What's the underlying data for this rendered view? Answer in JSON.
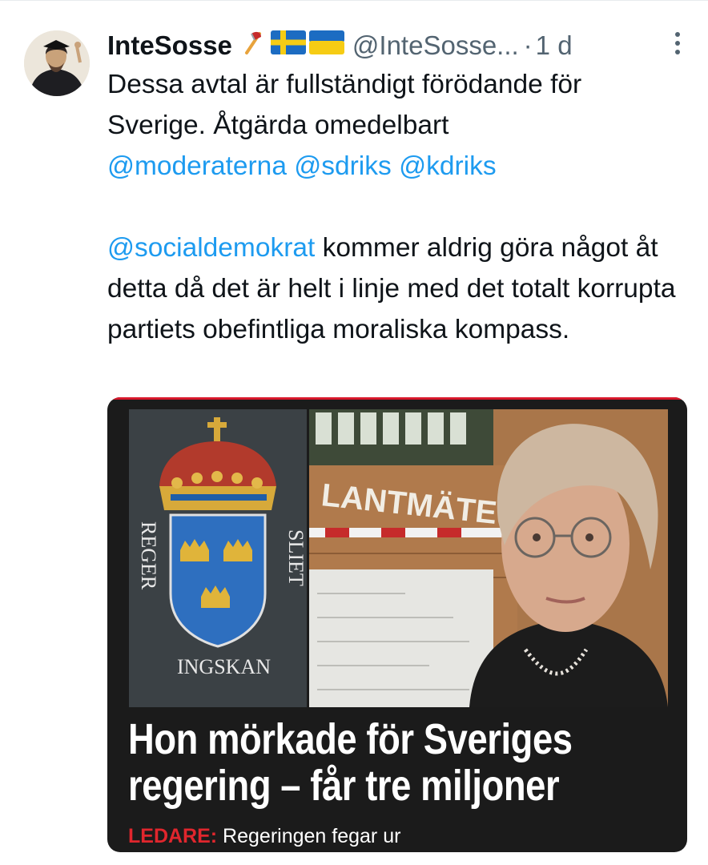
{
  "tweet": {
    "display_name": "InteSosse",
    "handle": "@InteSosse...",
    "separator": "·",
    "time": "1 d",
    "text_line1": "Dessa avtal är fullständigt förödande för Sverige. Åtgärda omedelbart",
    "mentions_line": [
      "@moderaterna",
      "@sdriks",
      "@kdriks"
    ],
    "mention_second": "@socialdemokrat",
    "text_line2": " kommer aldrig göra något åt detta då det är helt i linje med det totalt korrupta partiets obefintliga moraliska kompass."
  },
  "media": {
    "sign_text": "LANTMÄTE",
    "emblem_text": "REGERINGSKANSLIET",
    "headline": "Hon mörkade för Sveriges regering – får tre miljoner",
    "sub_label": "LEDARE:",
    "sub_text": " Regeringen fegar ur"
  },
  "icons": {
    "emoji_axe": "axe-emoji",
    "flag_sweden": "sweden-flag-emoji",
    "flag_ukraine": "ukraine-flag-emoji",
    "more": "more-vertical-icon"
  },
  "colors": {
    "link": "#1d9bf0",
    "muted": "#536471",
    "text": "#0f1419",
    "label_red": "#e0262d"
  }
}
